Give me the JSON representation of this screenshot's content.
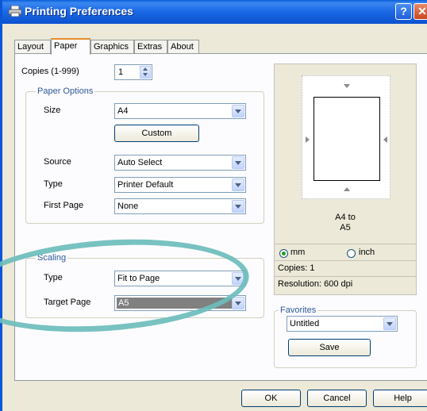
{
  "window": {
    "title": "Printing Preferences",
    "help_glyph": "?",
    "close_glyph": "✕"
  },
  "tabs": [
    {
      "label": "Layout"
    },
    {
      "label": "Paper"
    },
    {
      "label": "Graphics"
    },
    {
      "label": "Extras"
    },
    {
      "label": "About"
    }
  ],
  "copies": {
    "label": "Copies (1-999)",
    "value": "1"
  },
  "paper_options": {
    "title": "Paper Options",
    "size_label": "Size",
    "size_value": "A4",
    "custom_button": "Custom",
    "source_label": "Source",
    "source_value": "Auto Select",
    "type_label": "Type",
    "type_value": "Printer Default",
    "first_page_label": "First Page",
    "first_page_value": "None"
  },
  "scaling": {
    "title": "Scaling",
    "type_label": "Type",
    "type_value": "Fit to Page",
    "target_label": "Target Page",
    "target_value": "A5"
  },
  "preview": {
    "line1": "A4 to",
    "line2": "A5",
    "unit_mm": "mm",
    "unit_inch": "inch",
    "copies": "Copies: 1",
    "resolution": "Resolution: 600 dpi"
  },
  "favorites": {
    "title": "Favorites",
    "value": "Untitled",
    "save_button": "Save"
  },
  "footer": {
    "ok": "OK",
    "cancel": "Cancel",
    "help": "Help"
  },
  "colors": {
    "title_bar": "#0b52d0",
    "annotation_ellipse": "#6dbdbc",
    "selection": "#808080"
  }
}
